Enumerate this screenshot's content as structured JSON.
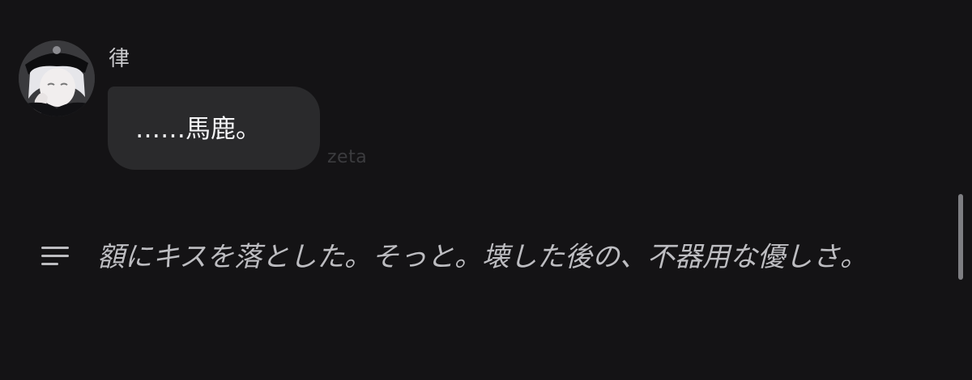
{
  "message": {
    "speaker_name": "律",
    "text": "……馬鹿。",
    "watermark": "zeta"
  },
  "narration": {
    "icon": "narration-lines-icon",
    "text": "額にキスを落とした。そっと。壊した後の、不器用な優しさ。"
  }
}
